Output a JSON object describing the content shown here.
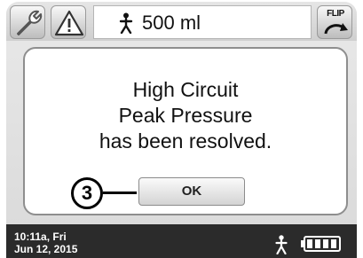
{
  "header": {
    "volume": "500 ml",
    "flip_label": "FLIP"
  },
  "dialog": {
    "message_lines": [
      "High Circuit",
      "Peak Pressure",
      "has been resolved."
    ],
    "ok_label": "OK"
  },
  "callout": {
    "number": "3"
  },
  "footer": {
    "time": "10:11a, Fri",
    "date": "Jun 12, 2015",
    "battery_bars": 4
  },
  "icons": {
    "wrench": "wrench-icon",
    "warning": "warning-icon",
    "flip": "flip-icon",
    "patient": "person-icon",
    "battery": "battery-icon"
  }
}
